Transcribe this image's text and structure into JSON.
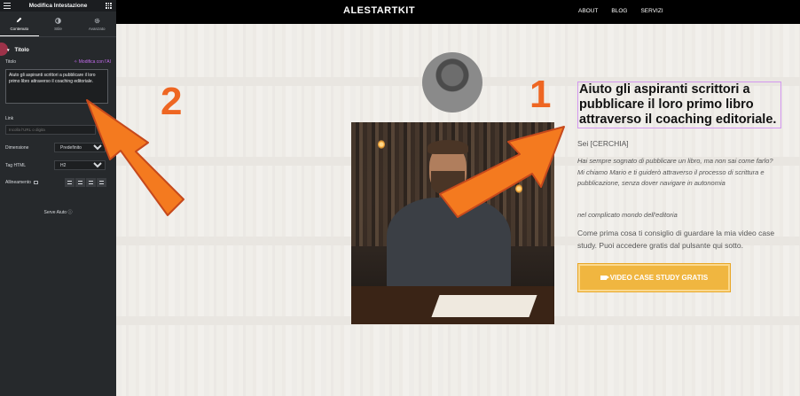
{
  "panel": {
    "title": "Modifica Intestazione",
    "tabs": [
      {
        "label": "Contenuto",
        "icon": "pencil-icon"
      },
      {
        "label": "Stile",
        "icon": "half-circle-icon"
      },
      {
        "label": "Avanzato",
        "icon": "gear-icon"
      }
    ],
    "section_title": "Titolo",
    "title_field_label": "Titolo",
    "ai_link": "Modifica con l'AI",
    "title_value": "Aiuto gli aspiranti scrittori a pubblicare il loro primo libro attraverso il coaching editoriale.",
    "link_label": "Link",
    "link_placeholder": "Incolla l'URL o digita",
    "size_label": "Dimensione",
    "size_value": "Predefinito",
    "tag_label": "Tag HTML",
    "tag_value": "H2",
    "align_label": "Allineamento",
    "help_label": "Serve Aiuto",
    "colors": {
      "bg": "#26292c",
      "ai": "#c56cf0"
    }
  },
  "site": {
    "logo": "ALESTARTKIT",
    "menu": [
      "ABOUT",
      "BLOG",
      "SERVIZI"
    ],
    "heading": "Aiuto gli aspiranti scrittori a pubblicare il loro primo libro attraverso il coaching editoriale.",
    "sub": "Sei [CERCHIA]",
    "intro": "Hai sempre sognato di pubblicare un libro, ma non sai come farlo? Mi chiamo Mario e ti guiderò attraverso il processo di scrittura e pubblicazione, senza dover navigare in autonomia",
    "intro2": "nel complicato mondo dell'editoria",
    "body": "Come prima cosa ti consiglio di guardare la mia video case study. Puoi accedere gratis dal pulsante qui sotto.",
    "cta": "VIDEO CASE STUDY GRATIS",
    "colors": {
      "cta": "#f0b640",
      "nav": "#000000"
    }
  },
  "annotations": {
    "labels": [
      "1",
      "2"
    ],
    "color": "#f47a1f"
  }
}
